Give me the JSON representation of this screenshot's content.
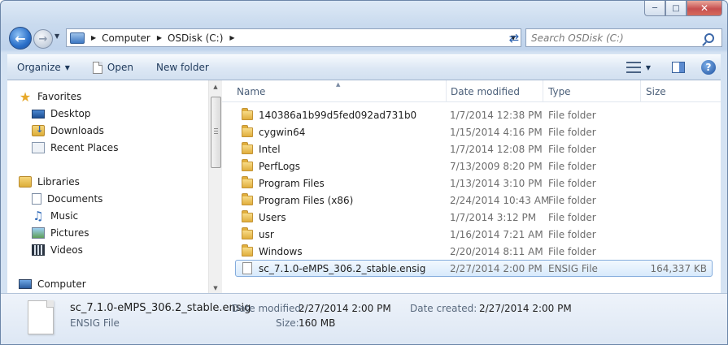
{
  "window": {
    "minimize": "─",
    "maximize": "□",
    "close": "✕"
  },
  "address": {
    "crumbs": [
      "Computer",
      "OSDisk (C:)"
    ]
  },
  "search": {
    "placeholder": "Search OSDisk (C:)"
  },
  "toolbar": {
    "organize": "Organize",
    "open": "Open",
    "new_folder": "New folder"
  },
  "sidebar": {
    "favorites": "Favorites",
    "desktop": "Desktop",
    "downloads": "Downloads",
    "recent_places": "Recent Places",
    "libraries": "Libraries",
    "documents": "Documents",
    "music": "Music",
    "pictures": "Pictures",
    "videos": "Videos",
    "computer": "Computer"
  },
  "columns": {
    "name": "Name",
    "date_modified": "Date modified",
    "type": "Type",
    "size": "Size"
  },
  "files": [
    {
      "name": "140386a1b99d5fed092ad731b0",
      "date": "1/7/2014 12:38 PM",
      "type": "File folder",
      "size": ""
    },
    {
      "name": "cygwin64",
      "date": "1/15/2014 4:16 PM",
      "type": "File folder",
      "size": ""
    },
    {
      "name": "Intel",
      "date": "1/7/2014 12:08 PM",
      "type": "File folder",
      "size": ""
    },
    {
      "name": "PerfLogs",
      "date": "7/13/2009 8:20 PM",
      "type": "File folder",
      "size": ""
    },
    {
      "name": "Program Files",
      "date": "1/13/2014 3:10 PM",
      "type": "File folder",
      "size": ""
    },
    {
      "name": "Program Files (x86)",
      "date": "2/24/2014 10:43 AM",
      "type": "File folder",
      "size": ""
    },
    {
      "name": "Users",
      "date": "1/7/2014 3:12 PM",
      "type": "File folder",
      "size": ""
    },
    {
      "name": "usr",
      "date": "1/16/2014 7:21 AM",
      "type": "File folder",
      "size": ""
    },
    {
      "name": "Windows",
      "date": "2/20/2014 8:11 AM",
      "type": "File folder",
      "size": ""
    },
    {
      "name": "sc_7.1.0-eMPS_306.2_stable.ensig",
      "date": "2/27/2014 2:00 PM",
      "type": "ENSIG File",
      "size": "164,337 KB"
    }
  ],
  "details": {
    "filename": "sc_7.1.0-eMPS_306.2_stable.ensig",
    "filetype": "ENSIG File",
    "date_modified_label": "Date modified:",
    "date_modified": "2/27/2014 2:00 PM",
    "size_label": "Size:",
    "size": "160 MB",
    "date_created_label": "Date created:",
    "date_created": "2/27/2014 2:00 PM"
  }
}
